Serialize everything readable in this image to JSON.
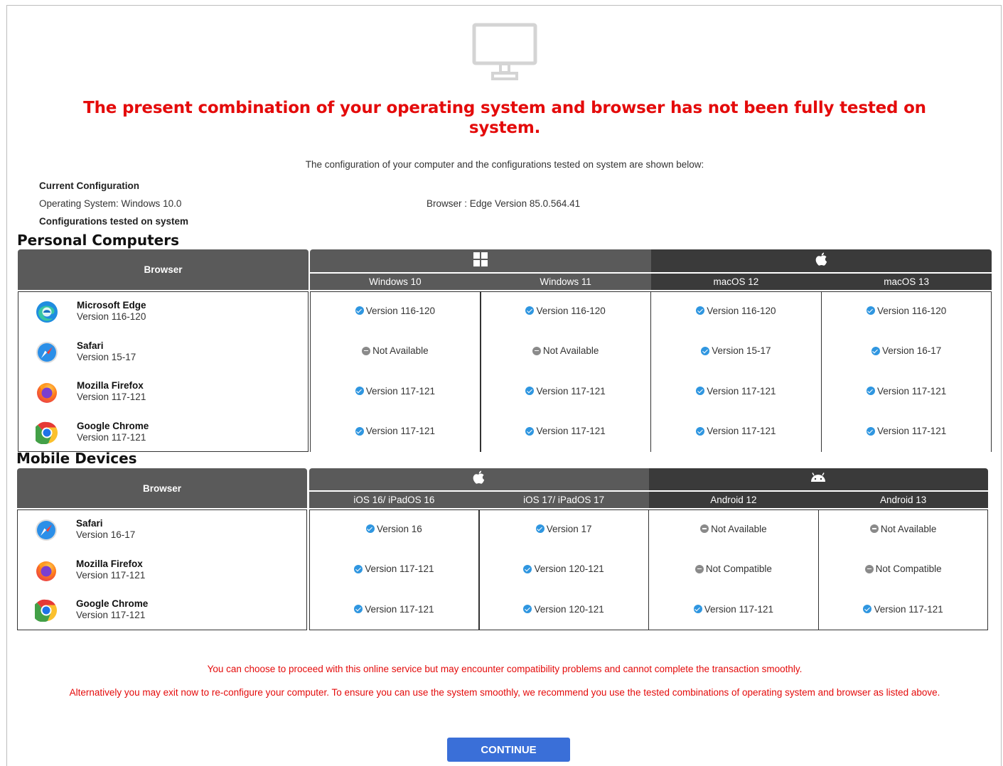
{
  "header": {
    "headline": "The present combination of your operating system and browser has not been fully tested on system.",
    "intro": "The configuration of your computer and the configurations tested on system are shown below:"
  },
  "current": {
    "title": "Current Configuration",
    "os": "Operating System: Windows 10.0",
    "browser": "Browser : Edge Version 85.0.564.41",
    "tested_title": "Configurations tested on system"
  },
  "pc": {
    "section_title": "Personal Computers",
    "browser_header": "Browser",
    "os_groups": [
      {
        "icon": "windows-icon"
      },
      {
        "icon": "apple-icon"
      }
    ],
    "columns": [
      "Windows 10",
      "Windows 11",
      "macOS 12",
      "macOS 13"
    ],
    "rows": [
      {
        "name": "Microsoft Edge",
        "version": "Version 116-120",
        "icon": "edge-icon",
        "cells": [
          [
            "ok",
            "Version 116-120"
          ],
          [
            "ok",
            "Version 116-120"
          ],
          [
            "ok",
            "Version 116-120"
          ],
          [
            "ok",
            "Version 116-120"
          ]
        ]
      },
      {
        "name": "Safari",
        "version": "Version 15-17",
        "icon": "safari-icon",
        "cells": [
          [
            "na",
            "Not Available"
          ],
          [
            "na",
            "Not Available"
          ],
          [
            "ok",
            "Version 15-17"
          ],
          [
            "ok",
            "Version 16-17"
          ]
        ]
      },
      {
        "name": "Mozilla Firefox",
        "version": "Version 117-121",
        "icon": "firefox-icon",
        "cells": [
          [
            "ok",
            "Version 117-121"
          ],
          [
            "ok",
            "Version 117-121"
          ],
          [
            "ok",
            "Version 117-121"
          ],
          [
            "ok",
            "Version 117-121"
          ]
        ]
      },
      {
        "name": "Google Chrome",
        "version": "Version 117-121",
        "icon": "chrome-icon",
        "cells": [
          [
            "ok",
            "Version 117-121"
          ],
          [
            "ok",
            "Version 117-121"
          ],
          [
            "ok",
            "Version 117-121"
          ],
          [
            "ok",
            "Version 117-121"
          ]
        ]
      }
    ]
  },
  "mobile": {
    "section_title": "Mobile Devices",
    "browser_header": "Browser",
    "os_groups": [
      {
        "icon": "apple-icon"
      },
      {
        "icon": "android-icon"
      }
    ],
    "columns": [
      "iOS 16/ iPadOS 16",
      "iOS 17/ iPadOS 17",
      "Android 12",
      "Android 13"
    ],
    "rows": [
      {
        "name": "Safari",
        "version": "Version 16-17",
        "icon": "safari-icon",
        "cells": [
          [
            "ok",
            "Version 16"
          ],
          [
            "ok",
            "Version 17"
          ],
          [
            "na",
            "Not Available"
          ],
          [
            "na",
            "Not Available"
          ]
        ]
      },
      {
        "name": "Mozilla Firefox",
        "version": "Version 117-121",
        "icon": "firefox-icon",
        "cells": [
          [
            "ok",
            "Version 117-121"
          ],
          [
            "ok",
            "Version 120-121"
          ],
          [
            "na",
            "Not Compatible"
          ],
          [
            "na",
            "Not Compatible"
          ]
        ]
      },
      {
        "name": "Google Chrome",
        "version": "Version 117-121",
        "icon": "chrome-icon",
        "cells": [
          [
            "ok",
            "Version 117-121"
          ],
          [
            "ok",
            "Version 120-121"
          ],
          [
            "ok",
            "Version 117-121"
          ],
          [
            "ok",
            "Version 117-121"
          ]
        ]
      }
    ]
  },
  "footer": {
    "notice1": "You can choose to proceed with this online service but may encounter compatibility problems and cannot complete the transaction smoothly.",
    "notice2": "Alternatively you may exit now to re-configure your computer. To ensure you can use the system smoothly, we recommend you use the tested combinations of operating system and browser as listed above.",
    "continue_label": "CONTINUE"
  },
  "colors": {
    "alert_red": "#e40b0b",
    "header_gray": "#5a5a5a",
    "header_dark": "#3a3a3a",
    "check_blue": "#2f96e0",
    "button_blue": "#3a6fd8"
  }
}
